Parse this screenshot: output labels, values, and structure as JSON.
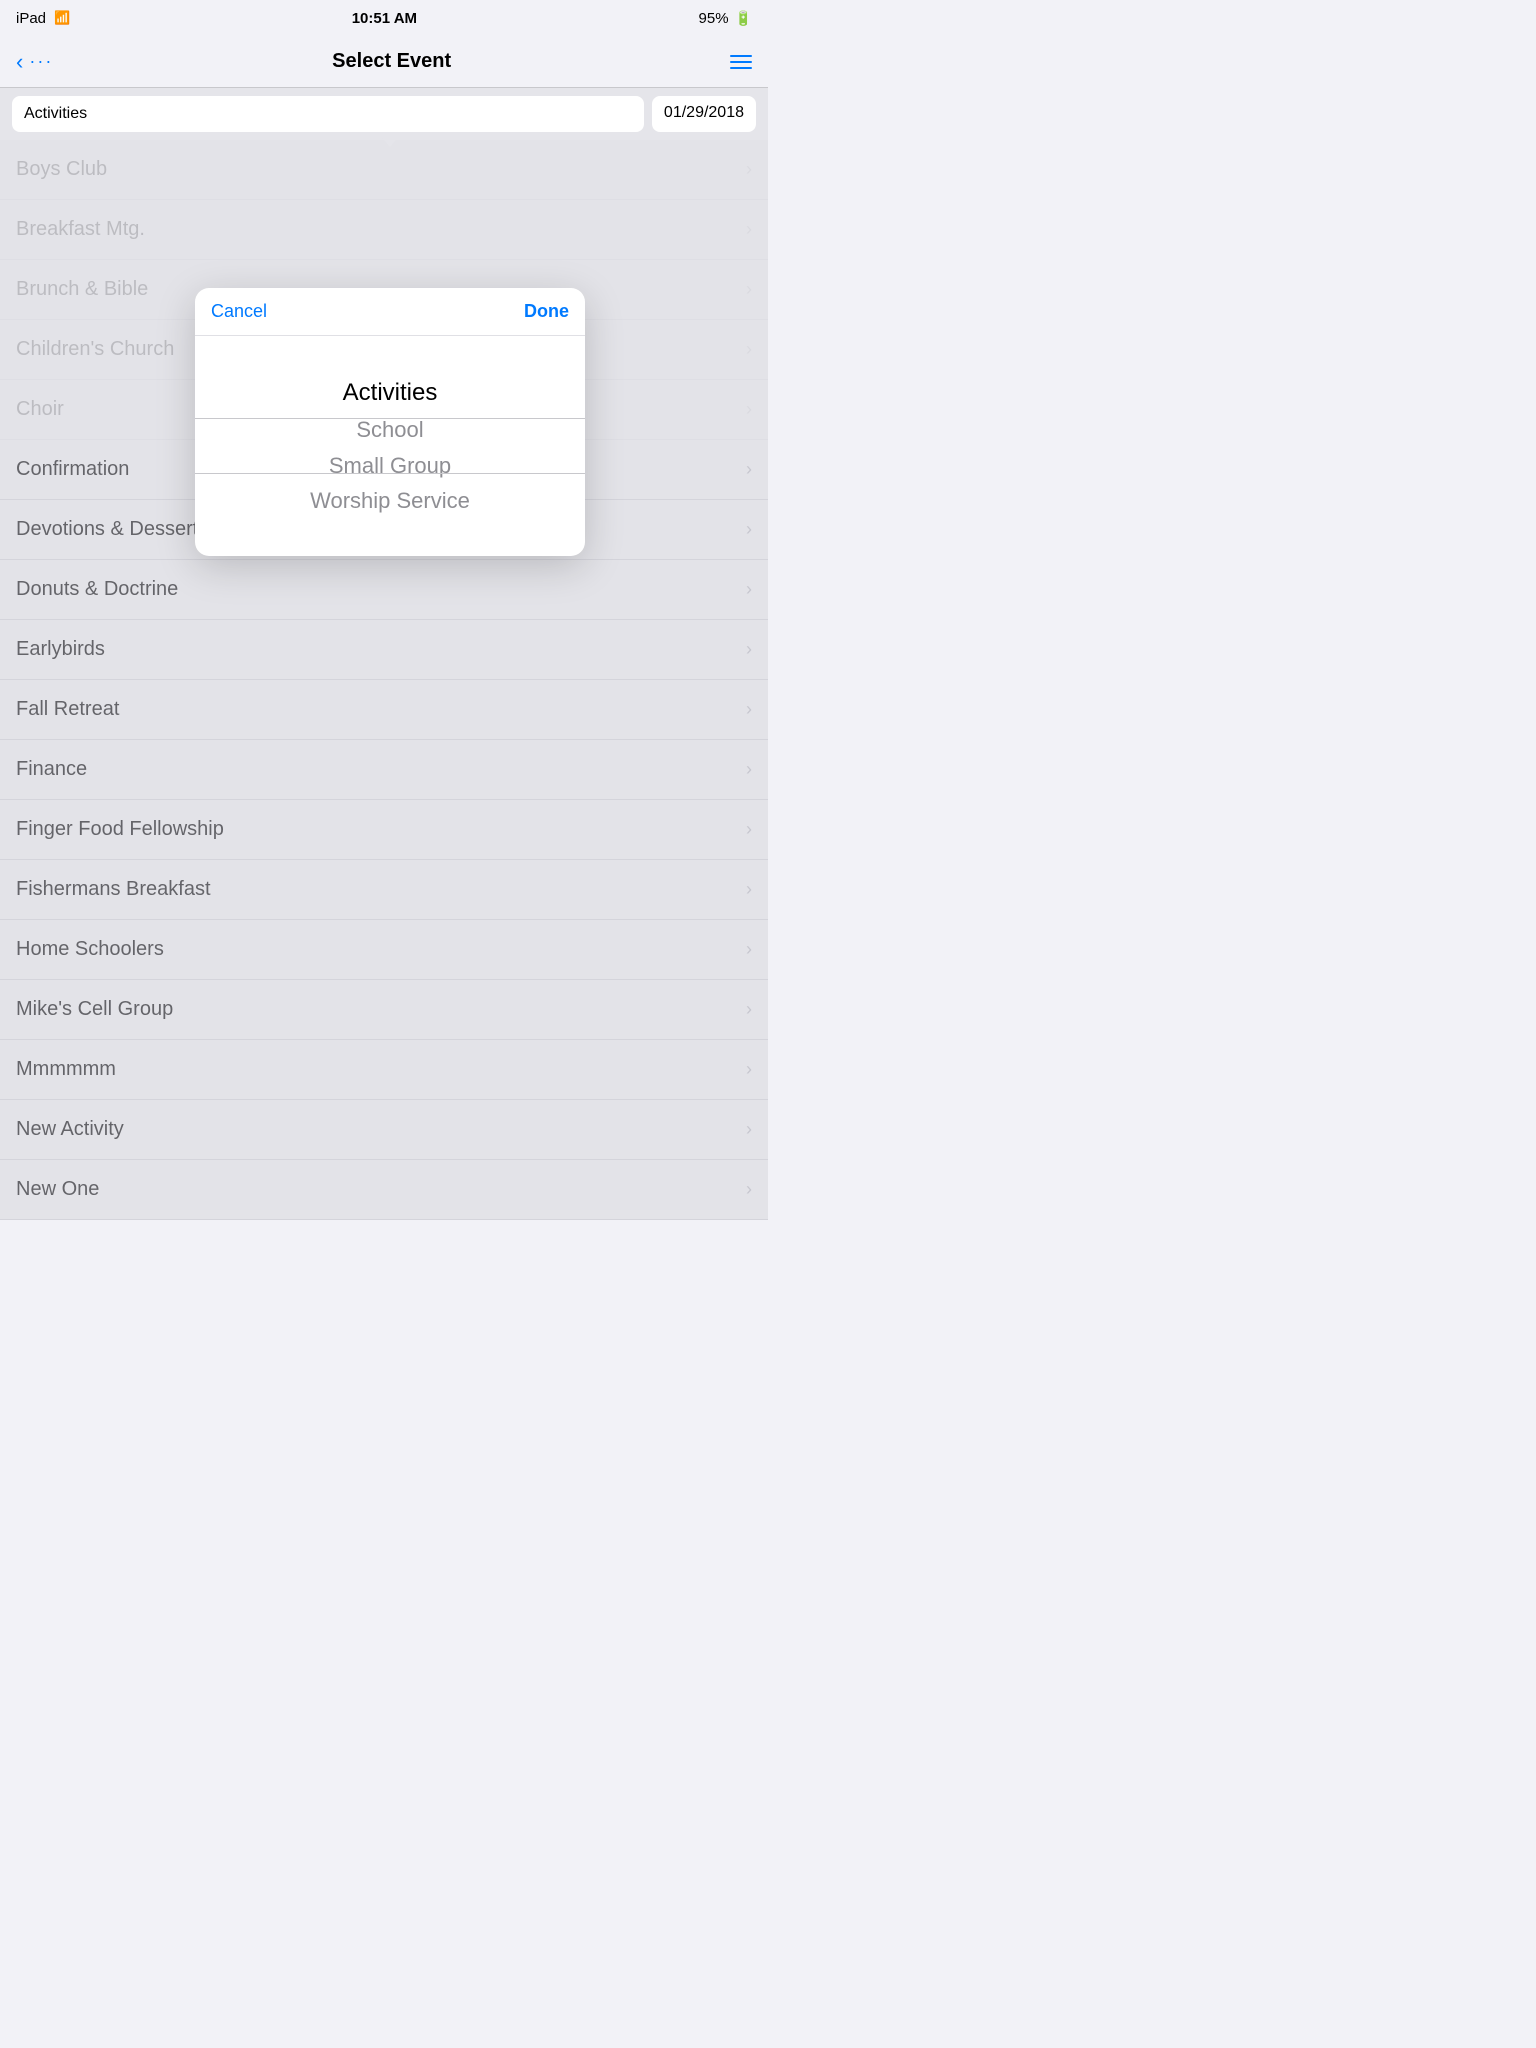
{
  "statusBar": {
    "carrier": "iPad",
    "wifi": "wifi",
    "time": "10:51 AM",
    "battery": "95%"
  },
  "navBar": {
    "title": "Select Event",
    "backLabel": "‹",
    "dotsLabel": "···",
    "menuLabel": "≡"
  },
  "filterRow": {
    "inputValue": "Activities",
    "dateValue": "01/29/2018"
  },
  "picker": {
    "cancelLabel": "Cancel",
    "doneLabel": "Done",
    "items": [
      {
        "label": "Activities",
        "selected": true
      },
      {
        "label": "School",
        "selected": false
      },
      {
        "label": "Small Group",
        "selected": false
      },
      {
        "label": "Worship Service",
        "selected": false
      }
    ]
  },
  "listItems": [
    {
      "label": "Boys Club",
      "dimmed": false
    },
    {
      "label": "Breakfast Mtg.",
      "dimmed": false
    },
    {
      "label": "Brunch & Bible",
      "dimmed": false
    },
    {
      "label": "Children's Church",
      "dimmed": false
    },
    {
      "label": "Choir",
      "dimmed": false
    },
    {
      "label": "Confirmation",
      "dimmed": false
    },
    {
      "label": "Devotions & Dessert",
      "dimmed": false
    },
    {
      "label": "Donuts & Doctrine",
      "dimmed": false
    },
    {
      "label": "Earlybirds",
      "dimmed": false
    },
    {
      "label": "Fall Retreat",
      "dimmed": false
    },
    {
      "label": "Finance",
      "dimmed": false
    },
    {
      "label": "Finger Food Fellowship",
      "dimmed": false
    },
    {
      "label": "Fishermans Breakfast",
      "dimmed": false
    },
    {
      "label": "Home Schoolers",
      "dimmed": false
    },
    {
      "label": "Mike's Cell Group",
      "dimmed": false
    },
    {
      "label": "Mmmmmm",
      "dimmed": false
    },
    {
      "label": "New Activity",
      "dimmed": false
    },
    {
      "label": "New One",
      "dimmed": false
    }
  ],
  "chevron": "›"
}
